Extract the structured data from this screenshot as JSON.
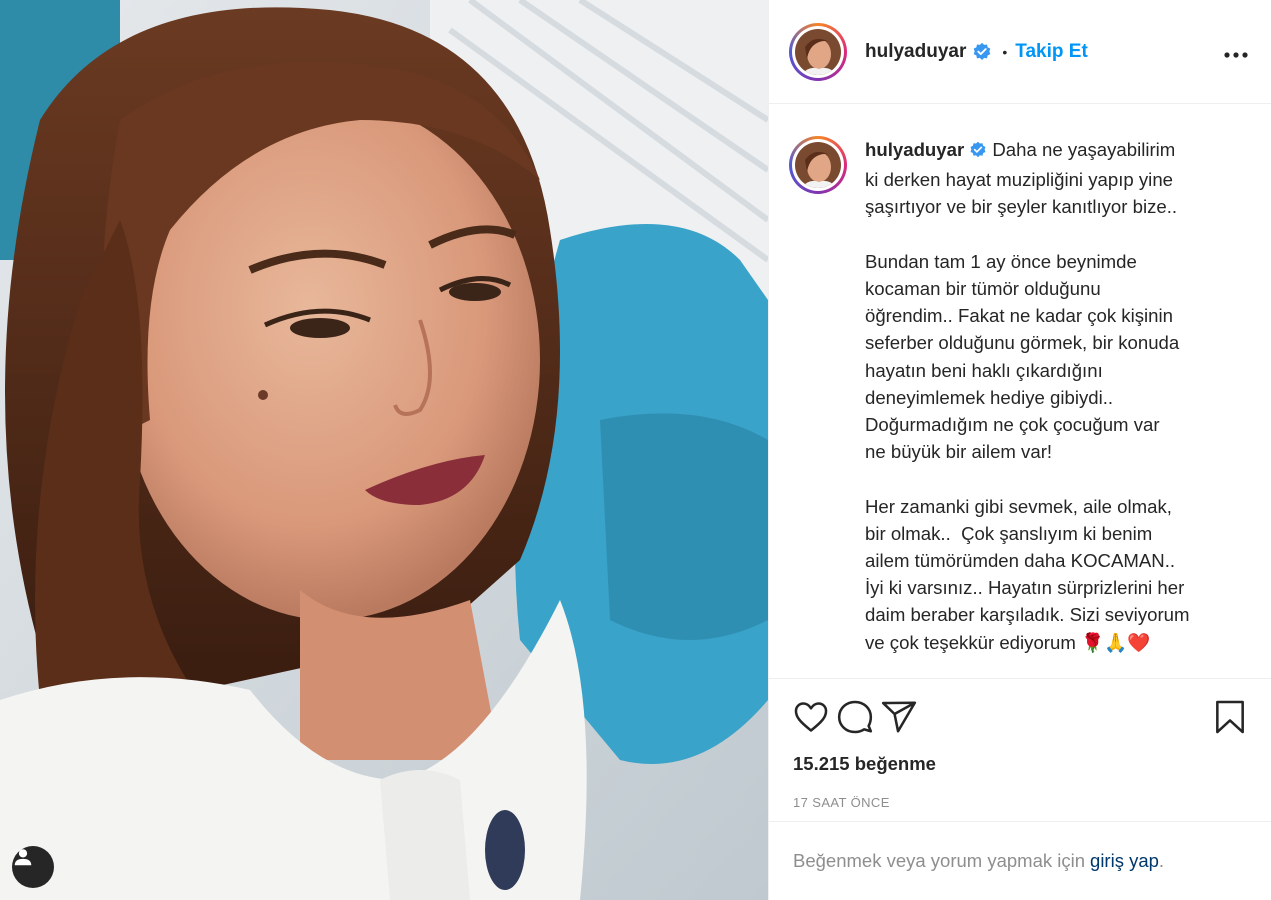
{
  "post": {
    "username": "hulyaduyar",
    "verified_icon": "verified-badge-icon",
    "follow_label": "Takip Et",
    "separator": "•",
    "more_label": "•••"
  },
  "caption": {
    "username": "hulyaduyar",
    "text": " Daha ne yaşayabilirim\nki derken hayat muzipliğini yapıp yine\nşaşırtıyor ve bir şeyler kanıtlıyor bize..\n\nBundan tam 1 ay önce beynimde\nkocaman bir tümör olduğunu\nöğrendim.. Fakat ne kadar çok kişinin\nseferber olduğunu görmek, bir konuda\nhayatın beni haklı çıkardığını\ndeneyimlemek hediye gibiydi..\nDoğurmadığım ne çok çocuğum var\nne büyük bir ailem var!\n\nHer zamanki gibi sevmek, aile olmak,\nbir olmak..  Çok şanslıyım ki benim\nailem tümörümden daha KOCAMAN..\nİyi ki varsınız.. Hayatın sürprizlerini her\ndaim beraber karşıladık. Sizi seviyorum\nve çok teşekkür ediyorum 🌹🙏❤️"
  },
  "stats": {
    "likes": "15.215 beğenme",
    "time": "17 SAAT ÖNCE"
  },
  "login": {
    "prompt": "Beğenmek veya yorum yapmak için",
    "link": "giriş yap",
    "suffix": "."
  },
  "icons": {
    "like": "heart-icon",
    "comment": "comment-icon",
    "share": "share-icon",
    "save": "bookmark-icon",
    "user_tag": "user-icon"
  },
  "colors": {
    "accent": "#0095f6",
    "muted": "#8e8e8e",
    "text": "#262626"
  }
}
